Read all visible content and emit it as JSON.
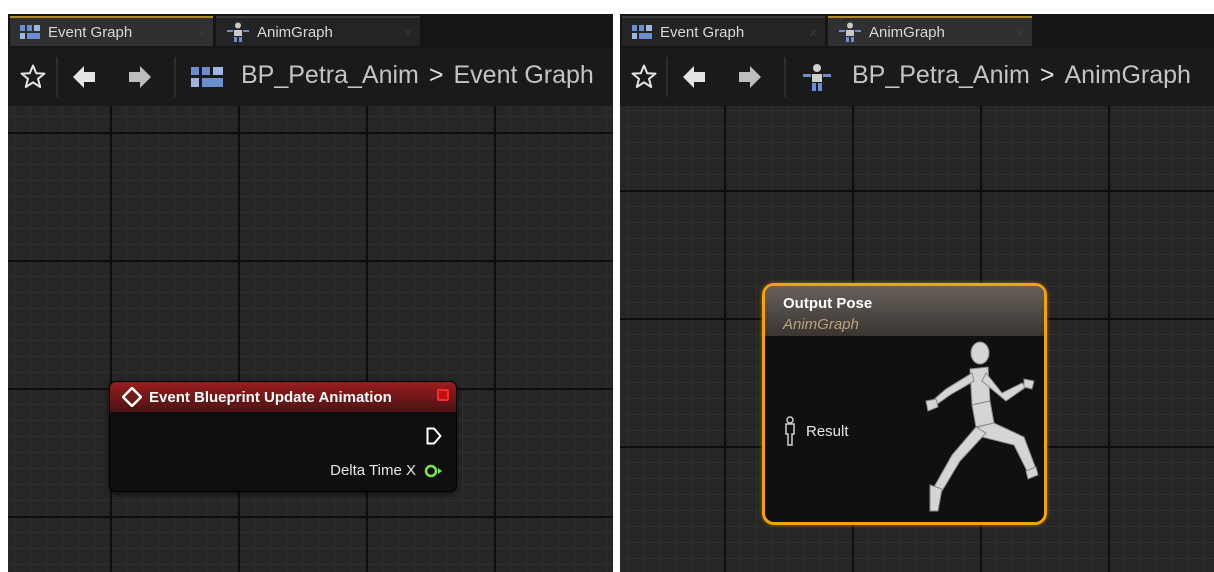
{
  "left_editor": {
    "tabs": [
      {
        "label": "Event Graph",
        "icon": "event-graph-icon",
        "active": true
      },
      {
        "label": "AnimGraph",
        "icon": "anim-graph-icon",
        "active": false
      }
    ],
    "breadcrumb": {
      "asset": "BP_Petra_Anim",
      "separator": ">",
      "graph": "Event Graph",
      "icon": "event-graph-icon"
    },
    "node": {
      "title": "Event Blueprint Update Animation",
      "exec_output": "exec",
      "pins": [
        {
          "label": "Delta Time X",
          "type": "float"
        }
      ]
    }
  },
  "right_editor": {
    "tabs": [
      {
        "label": "Event Graph",
        "icon": "event-graph-icon",
        "active": false
      },
      {
        "label": "AnimGraph",
        "icon": "anim-graph-icon",
        "active": true
      }
    ],
    "breadcrumb": {
      "asset": "BP_Petra_Anim",
      "separator": ">",
      "graph": "AnimGraph",
      "icon": "anim-graph-icon"
    },
    "node": {
      "title": "Output Pose",
      "subtitle": "AnimGraph",
      "pins": [
        {
          "label": "Result",
          "type": "pose"
        }
      ]
    }
  },
  "toolbar": {
    "favorite_icon": "star-icon",
    "back_icon": "arrow-left-icon",
    "forward_icon": "arrow-right-icon"
  },
  "tab_close_glyph": "×",
  "colors": {
    "event_header": "#9a1e1e",
    "output_border": "#f5a300",
    "float_pin": "#7ee84a",
    "active_tab_accent": "#b08d2a"
  }
}
